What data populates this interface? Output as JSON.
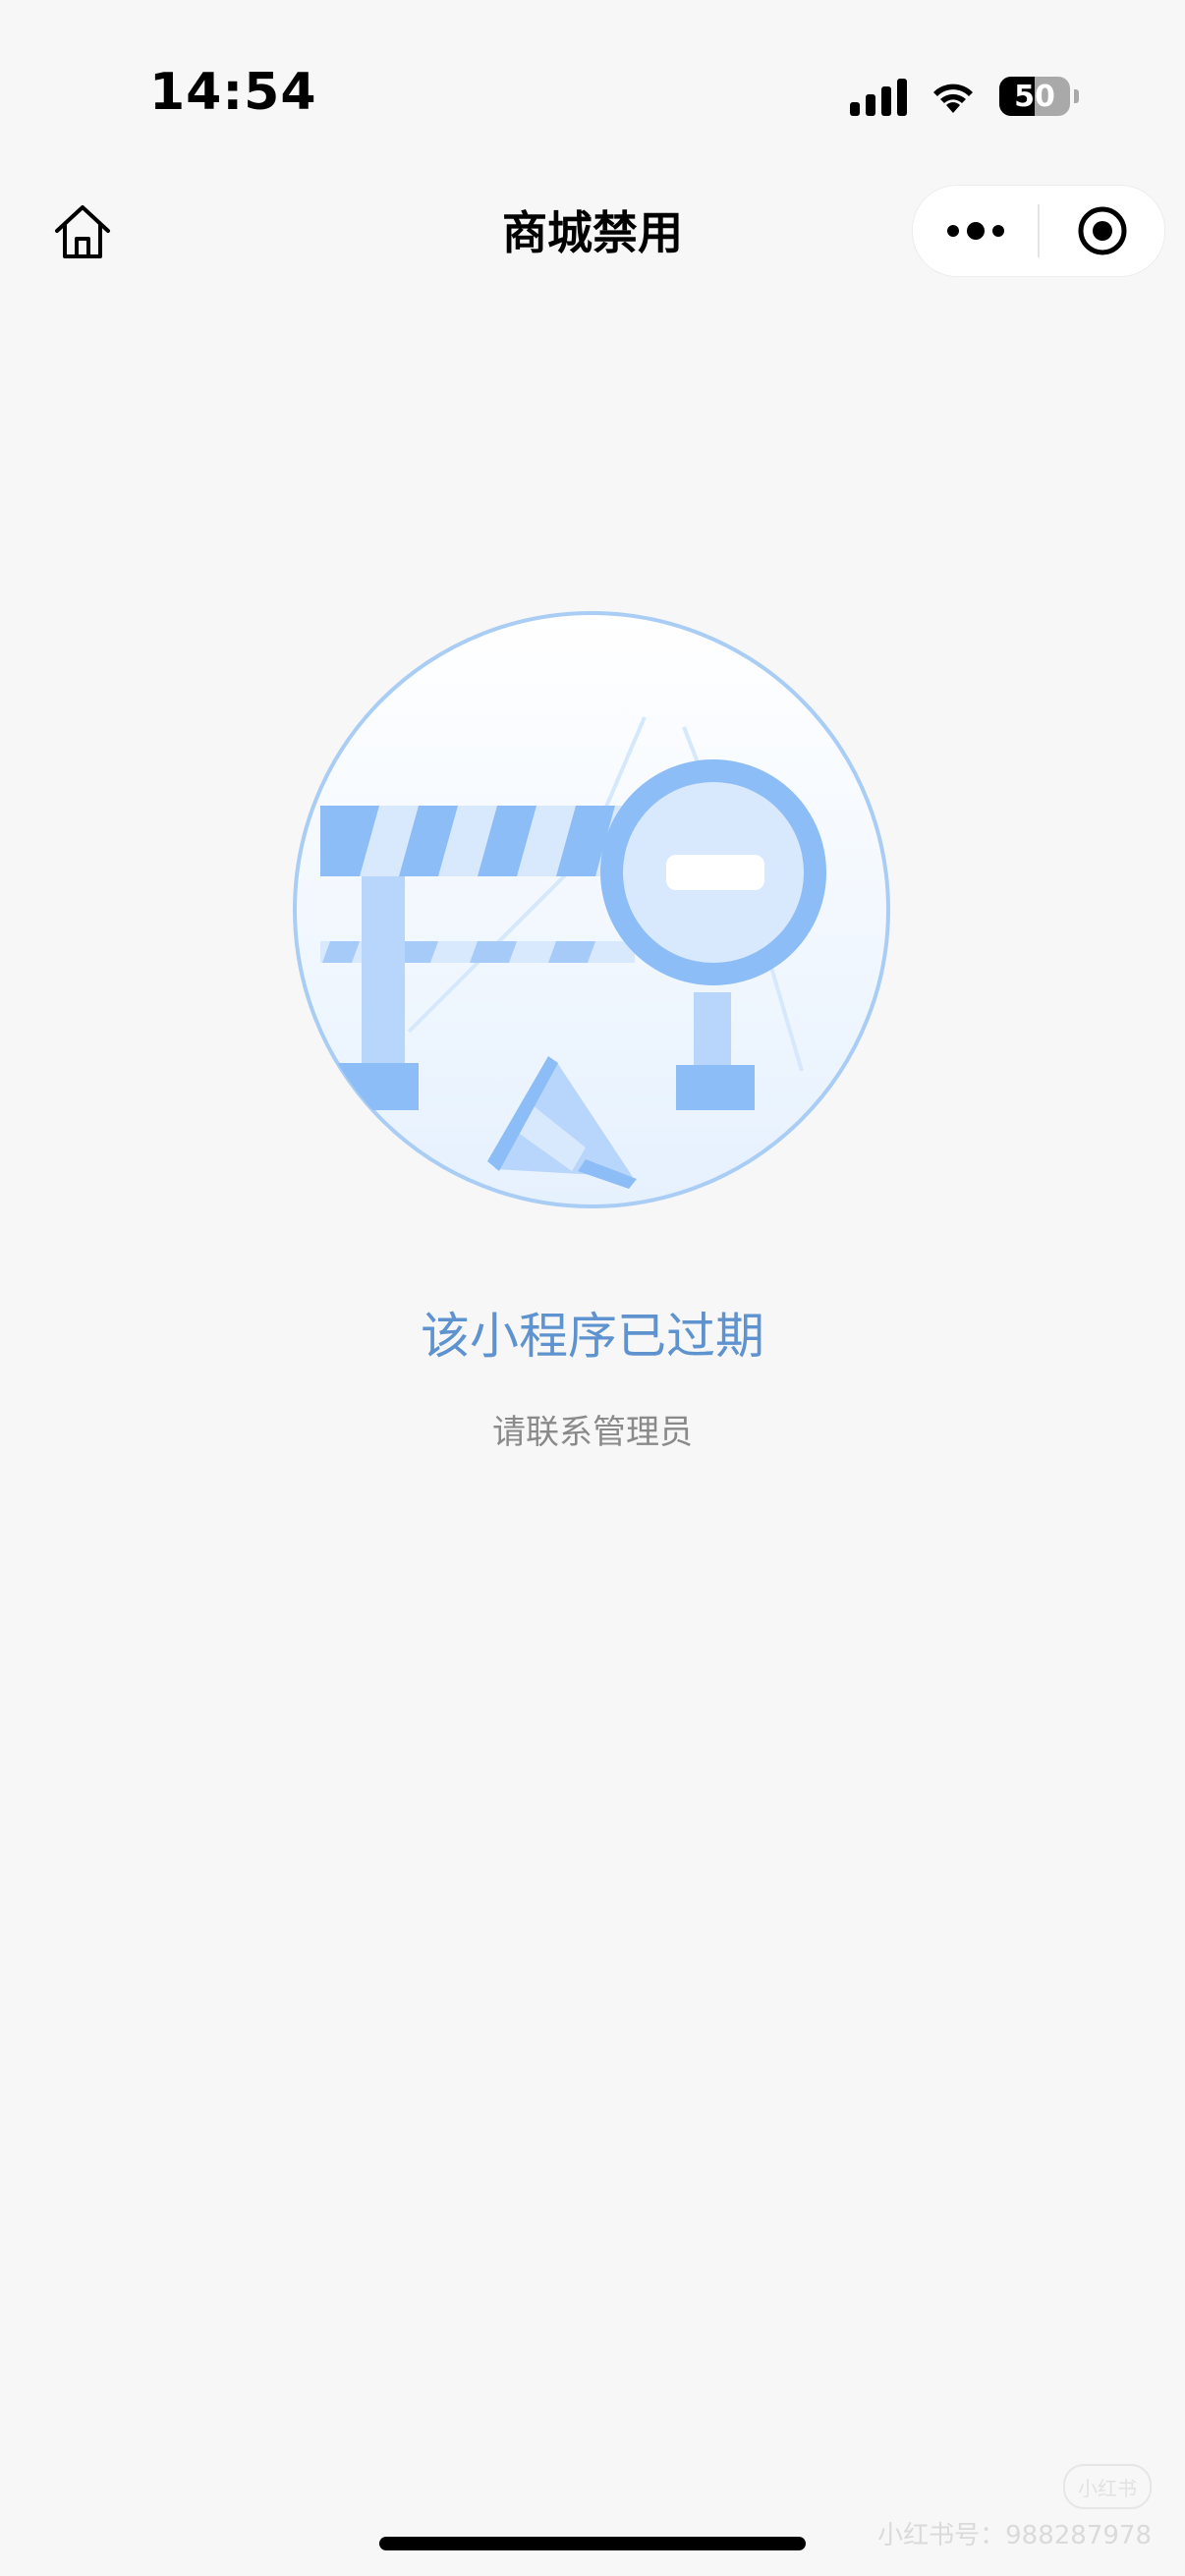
{
  "status_bar": {
    "time": "14:54",
    "battery": "50",
    "battery_level": 0.5,
    "icons": [
      "cellular-signal-icon",
      "wifi-icon",
      "battery-icon"
    ]
  },
  "nav": {
    "title": "商城禁用",
    "icons": [
      "home-icon",
      "more-dots-icon",
      "close-target-icon"
    ]
  },
  "main": {
    "illustration": "barrier-no-entry-illustration",
    "title": "该小程序已过期",
    "subtitle": "请联系管理员"
  },
  "watermark": {
    "badge": "小红书",
    "text": "小红书号：988287978"
  },
  "colors": {
    "background": "#f7f7f7",
    "accent": "#5e93cf",
    "illustration_blue": "#8dbdf6",
    "subtitle": "#8a8a8a"
  }
}
